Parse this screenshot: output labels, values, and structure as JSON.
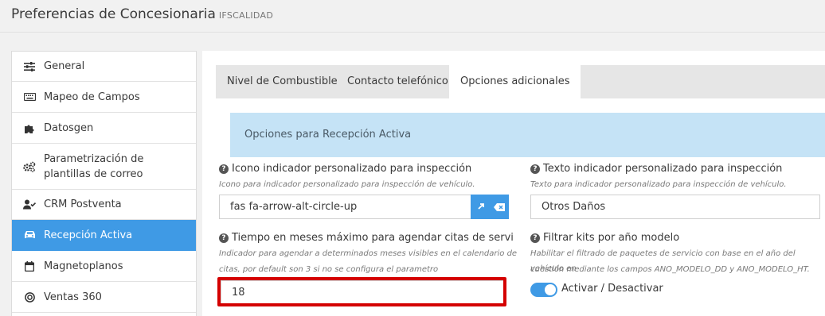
{
  "header": {
    "title": "Preferencias de Concesionaria",
    "subtitle": "IFSCALIDAD"
  },
  "sidebar": {
    "items": [
      {
        "label": "General",
        "icon": "sliders-icon"
      },
      {
        "label": "Mapeo de Campos",
        "icon": "keyboard-icon"
      },
      {
        "label": "Datosgen",
        "icon": "puzzle-icon"
      },
      {
        "label": "Parametrización de plantillas de correo",
        "icon": "gears-icon"
      },
      {
        "label": "CRM Postventa",
        "icon": "user-check-icon"
      },
      {
        "label": "Recepción Activa",
        "icon": "car-icon",
        "active": true
      },
      {
        "label": "Magnetoplanos",
        "icon": "calendar-icon"
      },
      {
        "label": "Ventas 360",
        "icon": "target-icon"
      }
    ]
  },
  "tabs": [
    {
      "label": "Nivel de Combustible"
    },
    {
      "label": "Contacto telefónico"
    },
    {
      "label": "Opciones adicionales",
      "active": true
    }
  ],
  "info": {
    "text": "Opciones para Recepción Activa"
  },
  "fields": {
    "icono": {
      "label": "Icono indicador personalizado para inspección",
      "help": "Icono para indicador personalizado para inspección de vehículo.",
      "value": "fas fa-arrow-alt-circle-up"
    },
    "texto": {
      "label": "Texto indicador personalizado para inspección",
      "help": "Texto para indicador personalizado para inspección de vehículo.",
      "value": "Otros Daños"
    },
    "tiempo": {
      "label": "Tiempo en meses máximo para agendar citas de servi",
      "help_line1": "Indicador para agendar a determinados meses visibles en el calendario de",
      "help_line2": "citas, por default son 3 si no se configura el parametro",
      "value": "18"
    },
    "filtrar": {
      "label": "Filtrar kits por año modelo",
      "help_line1": "Habilitar el filtrado de paquetes de servicio con base en el año del vehículo en",
      "help_line2": "cuestión mediante los campos ANO_MODELO_DD y ANO_MODELO_HT.",
      "toggle_label": "Activar / Desactivar",
      "enabled": true
    }
  },
  "colors": {
    "accent": "#3f9ae5",
    "info_bg": "#c5e3f6",
    "highlight": "#d40000"
  }
}
